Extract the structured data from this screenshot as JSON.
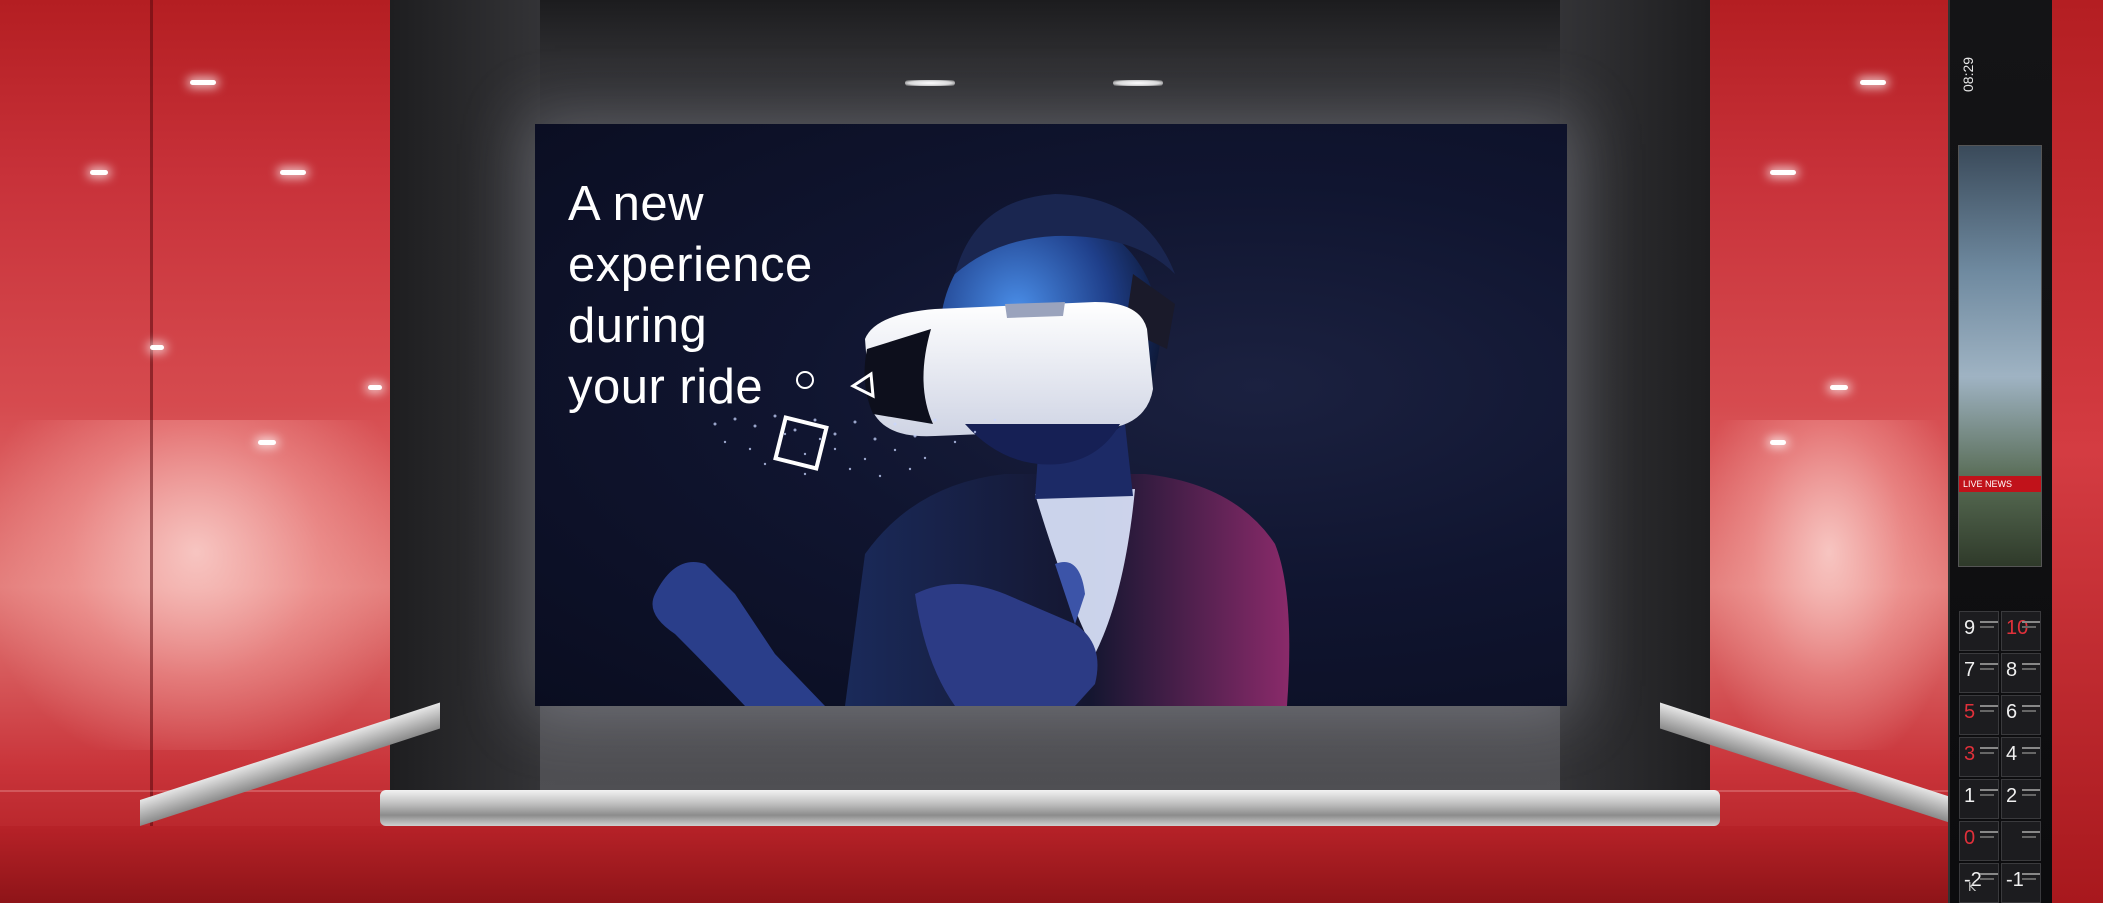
{
  "advertisement": {
    "headline_lines": [
      "A new",
      "experience",
      "during",
      "your ride"
    ]
  },
  "side_panel": {
    "time_text": "08:29",
    "news_label": "LIVE NEWS",
    "floor_buttons": [
      {
        "floor": "9",
        "active": false
      },
      {
        "floor": "10",
        "active": true
      },
      {
        "floor": "7",
        "active": false
      },
      {
        "floor": "8",
        "active": false
      },
      {
        "floor": "5",
        "active": true
      },
      {
        "floor": "6",
        "active": false
      },
      {
        "floor": "3",
        "active": true
      },
      {
        "floor": "4",
        "active": false
      },
      {
        "floor": "1",
        "active": false
      },
      {
        "floor": "2",
        "active": false
      },
      {
        "floor": "0",
        "active": true
      },
      {
        "floor": "",
        "active": false
      },
      {
        "floor": "-2",
        "active": false
      },
      {
        "floor": "-1",
        "active": false
      }
    ]
  },
  "colors": {
    "wall_red": "#c8323a",
    "screen_bg": "#101530",
    "headline": "#ffffff",
    "vr_headset": "#f2f2f2",
    "neon_blue": "#3a7bd5",
    "neon_pink": "#c2307a"
  }
}
